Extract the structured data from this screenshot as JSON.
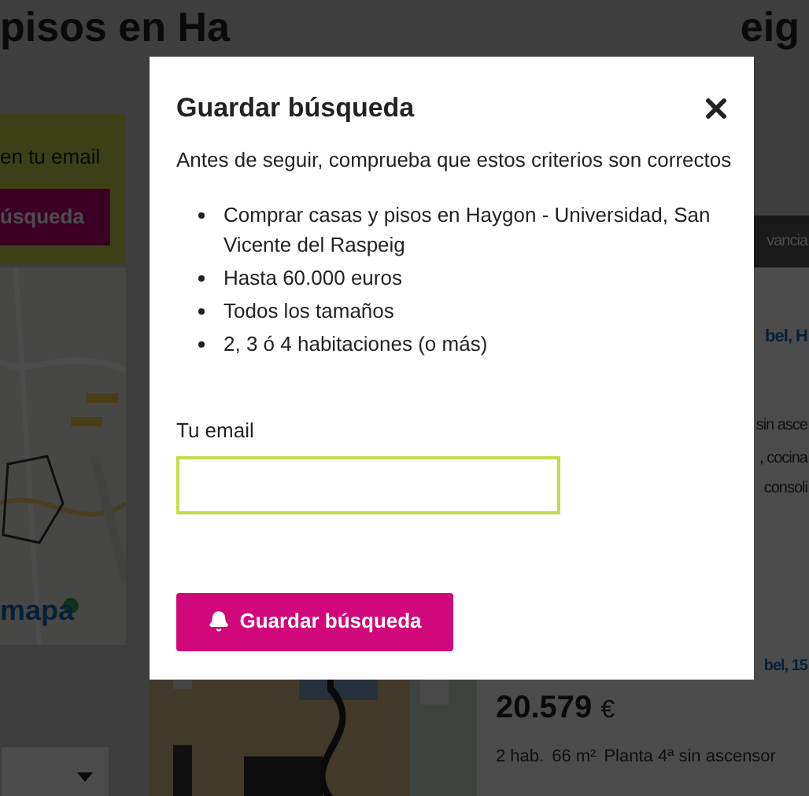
{
  "page": {
    "title_left": "pisos en Ha",
    "title_right": "eig",
    "promo": {
      "text": "en tu email",
      "button": "úsqueda"
    },
    "map": {
      "kind": "picture",
      "link": "mapa"
    },
    "tab": "vancia",
    "listing_1": {
      "title": "bel, H",
      "lines": [
        "sin asce",
        ", cocina",
        "consoli"
      ]
    },
    "listing_2": {
      "title": "bel, 15",
      "price": "20.579",
      "currency": "€",
      "features": [
        "2 hab.",
        "66 m²",
        "Planta 4ª sin ascensor"
      ]
    }
  },
  "dialog": {
    "title": "Guardar búsqueda",
    "intro": "Antes de seguir, comprueba que estos criterios son correctos",
    "criteria": [
      "Comprar casas y pisos en Haygon - Universidad, San Vicente del Raspeig",
      "Hasta 60.000 euros",
      "Todos los tamaños",
      "2, 3 ó 4 habitaciones (o más)"
    ],
    "email_label": "Tu email",
    "button": "Guardar búsqueda"
  }
}
